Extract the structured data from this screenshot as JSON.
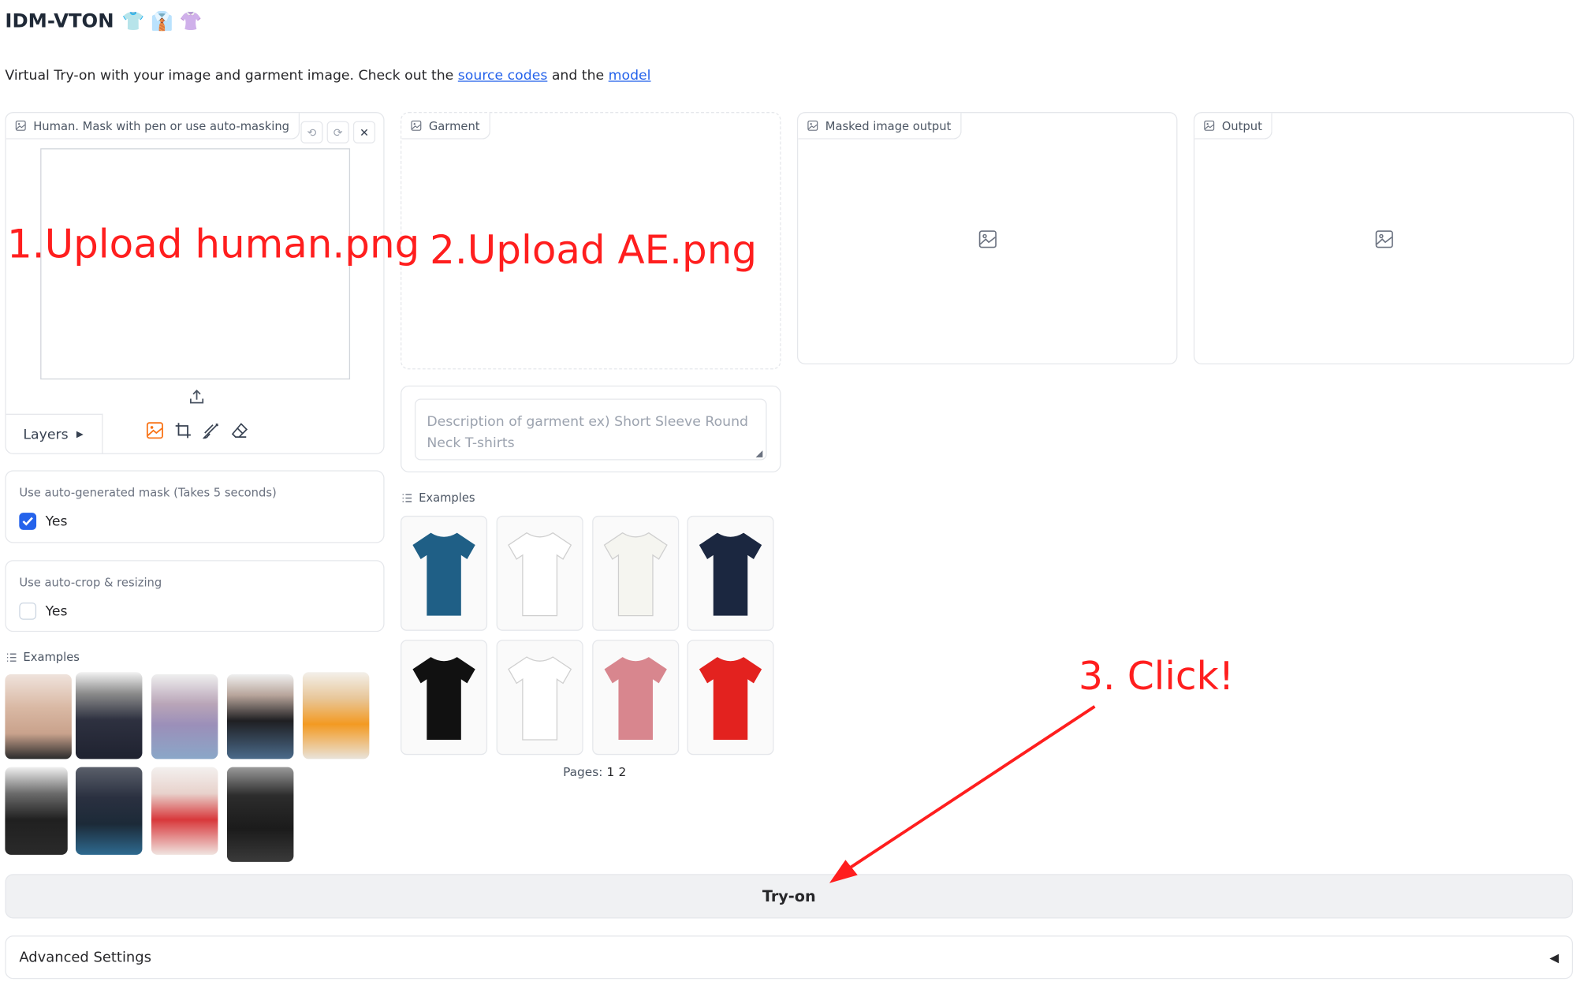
{
  "app": {
    "title": "IDM-VTON",
    "title_emojis": [
      "👕",
      "👔",
      "👚"
    ],
    "description_prefix": "Virtual Try-on with your image and garment image. Check out the ",
    "source_link": "source codes",
    "description_mid": " and the ",
    "model_link": "model"
  },
  "human_panel": {
    "label": "Human. Mask with pen or use auto-masking",
    "layers_label": "Layers"
  },
  "garment_panel": {
    "label": "Garment"
  },
  "masked_panel": {
    "label": "Masked image output"
  },
  "output_panel": {
    "label": "Output"
  },
  "garment_description": {
    "placeholder": "Description of garment ex) Short Sleeve Round Neck T-shirts"
  },
  "auto_mask": {
    "label": "Use auto-generated mask (Takes 5 seconds)",
    "option": "Yes",
    "checked": true
  },
  "auto_crop": {
    "label": "Use auto-crop & resizing",
    "option": "Yes",
    "checked": false
  },
  "human_examples": {
    "label": "Examples"
  },
  "garment_examples": {
    "label": "Examples",
    "pages_label": "Pages:",
    "pages": [
      "1",
      "2"
    ],
    "items": [
      {
        "name": "blue-velvet-wrap-top",
        "color": "#1f5f86"
      },
      {
        "name": "minnie-mouse-tshirt",
        "color": "#ffffff"
      },
      {
        "name": "white-button-camisole",
        "color": "#f5f5f0"
      },
      {
        "name": "navy-lightblue-polo",
        "color": "#1b2740"
      },
      {
        "name": "black-stussy-tshirt",
        "color": "#111111"
      },
      {
        "name": "white-gucci-tshirt",
        "color": "#ffffff"
      },
      {
        "name": "pink-striped-shirt",
        "color": "#d8868e"
      },
      {
        "name": "red-wrap-tshirt",
        "color": "#e3221f"
      }
    ]
  },
  "try_on_button": "Try-on",
  "advanced_settings": {
    "label": "Advanced Settings",
    "arrow": "◀"
  },
  "annotations": {
    "step1": "1.Upload human.png",
    "step2": "2.Upload AE.png",
    "step3": "3. Click!",
    "color": "#ff1e1e"
  }
}
